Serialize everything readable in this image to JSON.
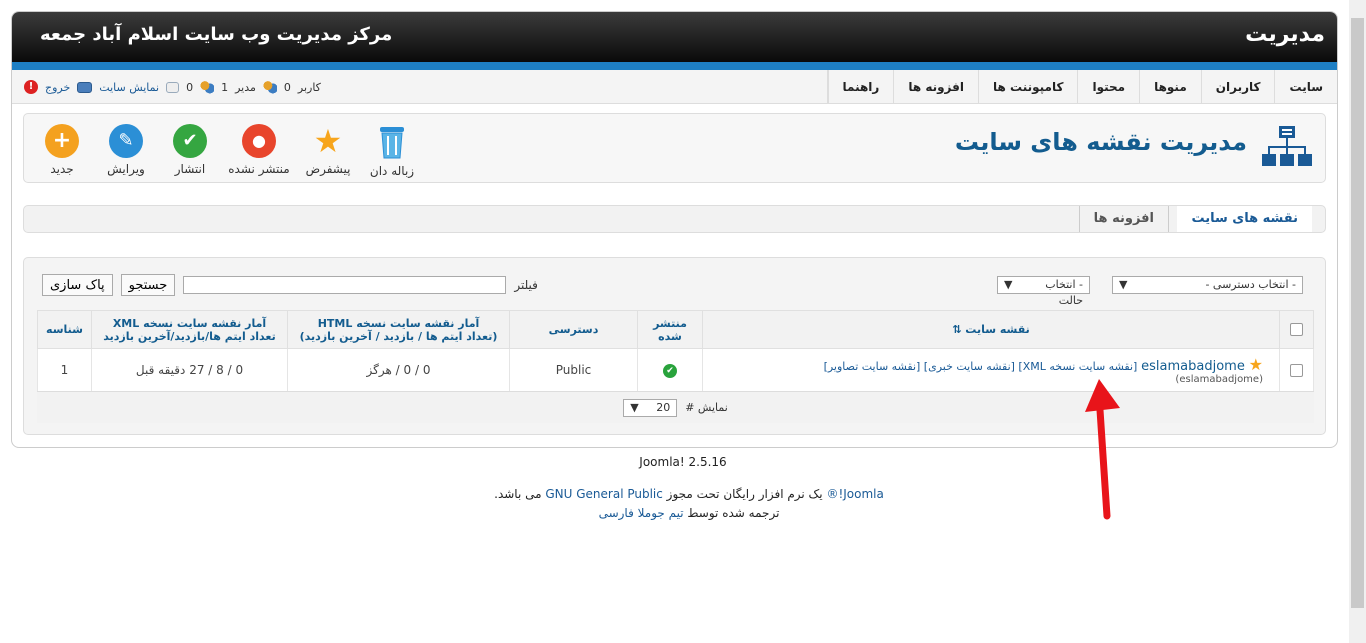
{
  "header": {
    "brand": "مدیریت",
    "site_name": "مرکز مدیریت وب سایت اسلام آباد جمعه"
  },
  "menu": [
    "سایت",
    "کاربران",
    "منوها",
    "محتوا",
    "کامپوننت ها",
    "افزونه ها",
    "راهنما"
  ],
  "status": {
    "users_count": "0",
    "users_label": "کاربر",
    "admins_count": "1",
    "admins_label": "مدیر",
    "messages_count": "0",
    "view_site": "نمایش سایت",
    "logout": "خروج"
  },
  "page": {
    "title": "مدیریت نقشه های سایت"
  },
  "toolbar": [
    {
      "label": "جدید",
      "color": "#f4a11f",
      "glyph": "+"
    },
    {
      "label": "ویرایش",
      "color": "#2b8fd6",
      "glyph": "✎"
    },
    {
      "label": "انتشار",
      "color": "#35a641",
      "glyph": "✔"
    },
    {
      "label": "منتشر نشده",
      "color": "#e8452c",
      "glyph": "●"
    },
    {
      "label": "پیشفرض",
      "color": "#f7a51c",
      "glyph": "★"
    },
    {
      "label": "زباله دان",
      "color": "#3b9fd6",
      "glyph": "🗑"
    }
  ],
  "tabs": {
    "sitemaps": "نقشه های سایت",
    "plugins": "افزونه ها"
  },
  "filter": {
    "label": "فیلتر",
    "search_button": "جستجو",
    "clear_button": "پاک سازی",
    "access_select": "- انتخاب دسترسی -",
    "state_select": "- انتخاب حالت"
  },
  "table": {
    "headers": {
      "sitemap": "نقشه سایت",
      "published": "منتشر شده",
      "access": "دسترسی",
      "html_stats_line1": "آمار نقشه سایت نسخه HTML",
      "html_stats_line2": "(تعداد ایتم ها / بازدید / آخرین بازدید)",
      "xml_stats_line1": "آمار نقشه سایت نسخه XML",
      "xml_stats_line2": "تعداد ایتم ها/بازدید/آخرین بازدید",
      "id": "شناسه"
    },
    "rows": [
      {
        "name": "eslamabadjome",
        "alias": "(eslamabadjome)",
        "links": "[نقشه سایت نسخه XML] [نقشه سایت خبری] [نقشه سایت تصاویر]",
        "access": "Public",
        "html_stats": "0 / 0 / هرگز",
        "xml_stats": "0 / 8 / 27 دقیقه قبل",
        "id": "1"
      }
    ]
  },
  "pager": {
    "label": "نمایش #",
    "value": "20"
  },
  "footer": {
    "version": "Joomla! 2.5.16",
    "license_link1": "Joomla!®",
    "license_text1": " یک نرم افزار رایگان تحت مجوز ",
    "license_link2": "GNU General Public",
    "license_text2": " می باشد.",
    "credit_text": "ترجمه شده توسط ",
    "credit_link": "تیم جوملا فارسی"
  }
}
